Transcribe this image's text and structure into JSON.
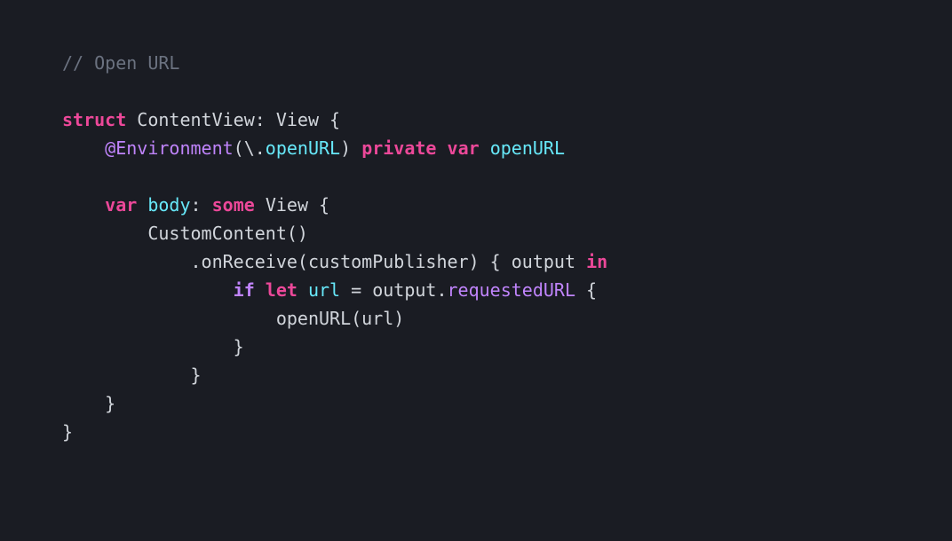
{
  "code": {
    "comment": "// Open URL",
    "struct_kw": "struct",
    "struct_name": "ContentView",
    "view_type": "View",
    "env_attr": "@Environment",
    "env_path": "openURL",
    "private_kw": "private",
    "var_kw": "var",
    "openurl_var": "openURL",
    "body_var": "body",
    "some_kw": "some",
    "custom_content": "CustomContent",
    "on_receive": "onReceive",
    "custom_publisher": "customPublisher",
    "output_param": "output",
    "in_kw": "in",
    "if_kw": "if",
    "let_kw": "let",
    "url_var": "url",
    "requested_url": "requestedURL",
    "openurl_call": "openURL",
    "url_arg": "url"
  }
}
